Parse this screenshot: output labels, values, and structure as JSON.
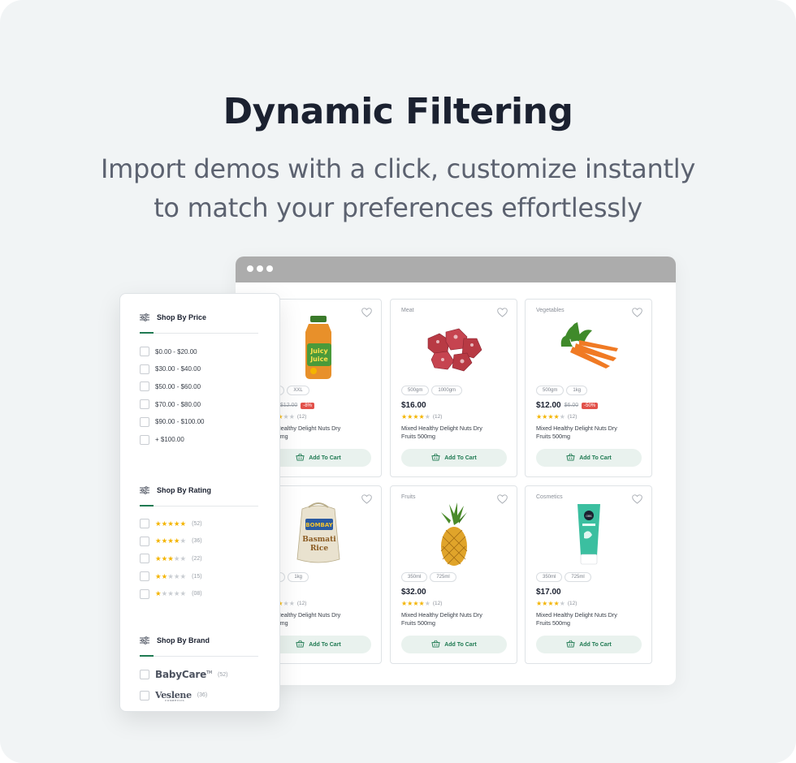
{
  "hero": {
    "title": "Dynamic Filtering",
    "subtitle_line1": "Import demos with a click, customize instantly",
    "subtitle_line2": "to match your preferences effortlessly"
  },
  "filter_panel": {
    "price": {
      "heading": "Shop By Price",
      "options": [
        "$0.00 - $20.00",
        "$30.00 - $40.00",
        "$50.00 - $60.00",
        "$70.00 - $80.00",
        "$90.00 - $100.00",
        "+ $100.00"
      ]
    },
    "rating": {
      "heading": "Shop By Rating",
      "options": [
        {
          "stars": 5,
          "count": "(52)"
        },
        {
          "stars": 4,
          "count": "(36)"
        },
        {
          "stars": 3,
          "count": "(22)"
        },
        {
          "stars": 2,
          "count": "(15)"
        },
        {
          "stars": 1,
          "count": "(08)"
        }
      ]
    },
    "brand": {
      "heading": "Shop By Brand",
      "options": [
        {
          "name": "BabyCare",
          "mark": "TM",
          "count": "(52)"
        },
        {
          "name": "Veslene",
          "subtext": "COSMETICS",
          "count": "(36)"
        }
      ]
    }
  },
  "products": [
    {
      "category": "",
      "tags": [
        "XL",
        "XXL"
      ],
      "price": ".00",
      "old_price": "$12.00",
      "discount": "-8%",
      "rating": 3,
      "reviews": "(12)",
      "name_line1": "xed Healthy Delight Nuts Dry",
      "name_line2": "s 500mg",
      "cart_label": "Add To Cart",
      "image": "juice-bottle"
    },
    {
      "category": "Meat",
      "tags": [
        "500gm",
        "1000gm"
      ],
      "price": "$16.00",
      "old_price": "",
      "discount": "",
      "rating": 4,
      "reviews": "(12)",
      "name_line1": "Mixed Healthy Delight Nuts Dry",
      "name_line2": "Fruits 500mg",
      "cart_label": "Add To Cart",
      "image": "meat-cubes"
    },
    {
      "category": "Vegetables",
      "tags": [
        "500gm",
        "1kg"
      ],
      "price": "$12.00",
      "old_price": "$6.00",
      "discount": "-50%",
      "rating": 4,
      "reviews": "(12)",
      "name_line1": "Mixed Healthy Delight Nuts Dry",
      "name_line2": "Fruits 500mg",
      "cart_label": "Add To Cart",
      "image": "carrots"
    },
    {
      "category": "",
      "tags": [
        "gm",
        "1kg"
      ],
      "price": ".00",
      "old_price": "",
      "discount": "",
      "rating": 3,
      "reviews": "(12)",
      "name_line1": "xed Healthy Delight Nuts Dry",
      "name_line2": "s 500mg",
      "cart_label": "Add To Cart",
      "image": "rice-bag"
    },
    {
      "category": "Fruits",
      "tags": [
        "350ml",
        "725ml"
      ],
      "price": "$32.00",
      "old_price": "",
      "discount": "",
      "rating": 4,
      "reviews": "(12)",
      "name_line1": "Mixed Healthy Delight Nuts Dry",
      "name_line2": "Fruits 500mg",
      "cart_label": "Add To Cart",
      "image": "pineapple"
    },
    {
      "category": "Cosmetics",
      "tags": [
        "350ml",
        "725ml"
      ],
      "price": "$17.00",
      "old_price": "",
      "discount": "",
      "rating": 4,
      "reviews": "(12)",
      "name_line1": "Mixed Healthy Delight Nuts Dry",
      "name_line2": "Fruits 500mg",
      "cart_label": "Add To Cart",
      "image": "cosmetic-tube"
    }
  ],
  "colors": {
    "accent": "#1f7a52",
    "star": "#f4b400",
    "discount": "#e2514a",
    "background": "#f1f4f5"
  }
}
